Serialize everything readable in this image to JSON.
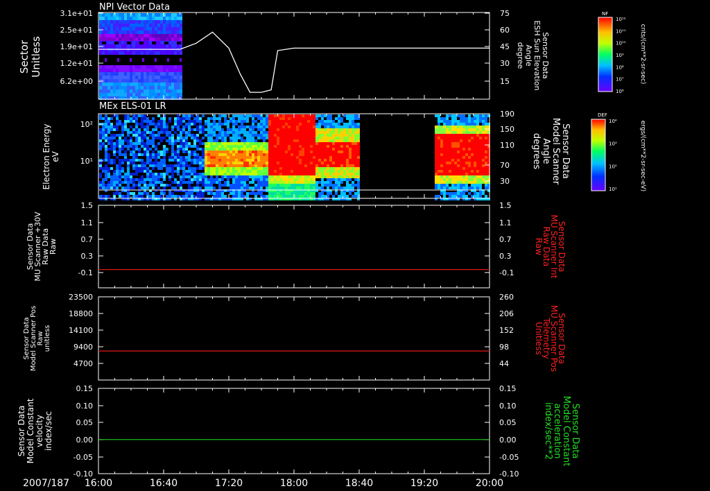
{
  "chart_data": [
    {
      "type": "heatmap",
      "title": "NPI Vector Data",
      "ylabel_left": [
        "Sector",
        "Unitless"
      ],
      "yticks_left": [
        "3.1e+01",
        "2.5e+01",
        "1.9e+01",
        "1.2e+01",
        "6.2e+00"
      ],
      "yticks_right": [
        "75",
        "60",
        "45",
        "30",
        "15"
      ],
      "ylabel_right": [
        "Sensor Data",
        "ESH Sun Elevation",
        "Angle",
        "degree"
      ],
      "ylim_right": [
        5,
        75
      ],
      "sun_elevation": {
        "x": [
          "16:00",
          "16:40",
          "16:50",
          "16:54",
          "17:00",
          "17:10",
          "17:20",
          "17:27",
          "17:33",
          "17:40",
          "17:46",
          "17:50",
          "18:00",
          "18:40",
          "19:20",
          "20:00"
        ],
        "y": [
          45,
          45,
          45,
          47,
          50,
          59,
          46,
          25,
          10,
          10,
          12,
          44,
          46,
          46,
          46,
          46
        ]
      },
      "data_interval": [
        "16:00",
        "16:50"
      ],
      "colorbar": {
        "label": "NF",
        "unit": "cnts/(cm**2-sr-sec)",
        "ticks": [
          "10¹²",
          "10¹¹",
          "10¹⁰",
          "10⁹",
          "10⁸",
          "10⁷",
          "10⁶"
        ]
      }
    },
    {
      "type": "heatmap",
      "title": "MEx ELS-01 LR",
      "ylabel_left": [
        "Electron Energy",
        "eV"
      ],
      "yticks_left": [
        "10²",
        "10¹"
      ],
      "yticks_right": [
        "190",
        "150",
        "110",
        "70",
        "30"
      ],
      "ylim_right": [
        0,
        190
      ],
      "ylabel_right": [
        "Sensor Data",
        "Model Scanner",
        "Angle",
        "degrees"
      ],
      "scanner_angle_line": 10,
      "data_gaps": [
        [
          "18:40",
          "19:20"
        ]
      ],
      "colorbar": {
        "label": "DEF",
        "unit": "ergs/(cm**2-sr-sec-eV)",
        "ticks": [
          "10⁴",
          "10³",
          "10²",
          "10¹"
        ]
      }
    },
    {
      "type": "line",
      "ylabel_left": [
        "Sensor Data",
        "MU Scanner +30V",
        "Raw Data",
        "Raw"
      ],
      "yticks_left": [
        "1.5",
        "1.1",
        "0.7",
        "0.3",
        "-0.1"
      ],
      "yticks_right": [
        "1.5",
        "1.1",
        "0.7",
        "0.3",
        "-0.1"
      ],
      "ylim": [
        -0.3,
        1.5
      ],
      "ylabel_right": [
        "Sensor Data",
        "MU Scanner Int",
        "Raw Data",
        "Raw"
      ],
      "series": [
        {
          "name": "",
          "color": "#e01818",
          "constant": 0.1
        }
      ]
    },
    {
      "type": "line",
      "ylabel_left": [
        "Sensor Data",
        "Model Scanner Pos",
        "Raw",
        "unitless"
      ],
      "yticks_left": [
        "23500",
        "18800",
        "14100",
        "9400",
        "4700"
      ],
      "yticks_right": [
        "260",
        "206",
        "152",
        "98",
        "44"
      ],
      "ylim": [
        0,
        23500
      ],
      "ylabel_right": [
        "Sensor Data",
        "MU Scanner Pos",
        "Telemetry",
        "Unitless"
      ],
      "series": [
        {
          "name": "",
          "color": "#e01818",
          "constant": 8200
        }
      ]
    },
    {
      "type": "line",
      "ylabel_left": [
        "Sensor Data",
        "Model Constant",
        "velocity",
        "index/sec"
      ],
      "yticks_left": [
        "0.15",
        "0.10",
        "0.05",
        "0.00",
        "-0.05",
        "-0.10"
      ],
      "yticks_right": [
        "0.15",
        "0.10",
        "0.05",
        "0.00",
        "-0.05",
        "-0.10"
      ],
      "ylim": [
        -0.1,
        0.15
      ],
      "ylabel_right": [
        "Sensor Data",
        "Model Constant",
        "acceleration",
        "index/sec**2"
      ],
      "series": [
        {
          "name": "",
          "color": "#22d022",
          "constant": 0.0
        }
      ]
    }
  ],
  "xaxis": {
    "date_label": "2007/187",
    "ticks": [
      "16:00",
      "16:40",
      "17:20",
      "18:00",
      "18:40",
      "19:20",
      "20:00"
    ],
    "xlim": [
      "16:00",
      "20:00"
    ]
  },
  "colors": {
    "right_label_red": "#ff2020",
    "right_label_green": "#22e022"
  }
}
